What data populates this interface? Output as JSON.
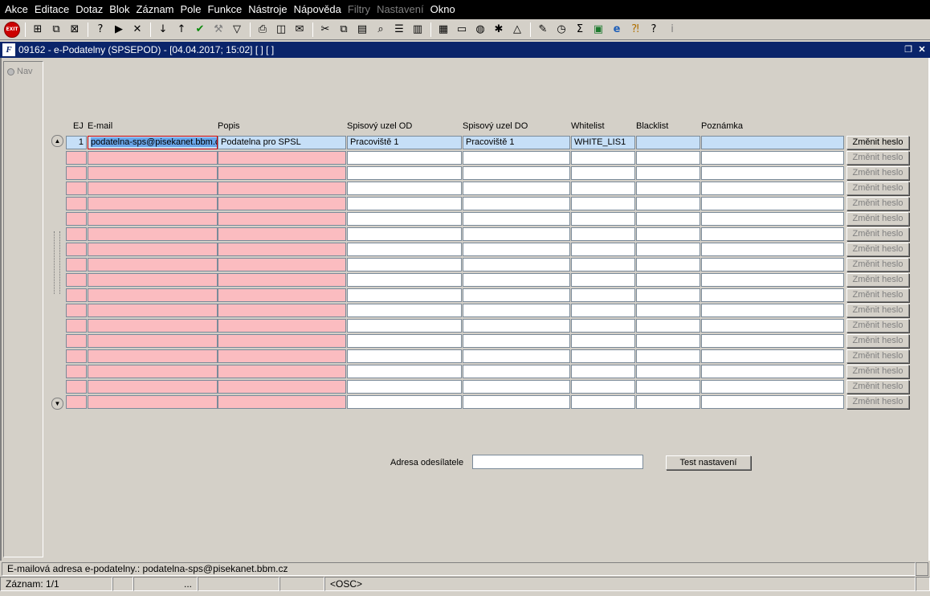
{
  "menu": [
    {
      "id": "akce",
      "label": "Akce",
      "disabled": false
    },
    {
      "id": "editace",
      "label": "Editace",
      "disabled": false
    },
    {
      "id": "dotaz",
      "label": "Dotaz",
      "disabled": false
    },
    {
      "id": "blok",
      "label": "Blok",
      "disabled": false
    },
    {
      "id": "zaznam",
      "label": "Záznam",
      "disabled": false
    },
    {
      "id": "pole",
      "label": "Pole",
      "disabled": false
    },
    {
      "id": "funkce",
      "label": "Funkce",
      "disabled": false
    },
    {
      "id": "nastroje",
      "label": "Nástroje",
      "disabled": false
    },
    {
      "id": "napoveda",
      "label": "Nápověda",
      "disabled": false
    },
    {
      "id": "filtry",
      "label": "Filtry",
      "disabled": true
    },
    {
      "id": "nastaveni",
      "label": "Nastavení",
      "disabled": true
    },
    {
      "id": "okno",
      "label": "Okno",
      "disabled": false
    }
  ],
  "toolbar": {
    "exit_label": "EXIT",
    "icons": [
      "exit-icon",
      "sep",
      "insert-record-icon",
      "duplicate-record-icon",
      "delete-record-icon",
      "sep",
      "query-enter-icon",
      "query-execute-icon",
      "query-cancel-icon",
      "sep",
      "sort-asc-icon",
      "sort-desc-icon",
      "commit-check-icon",
      "wrench-icon",
      "filter-icon",
      "sep",
      "print-icon",
      "print-preview-icon",
      "mail-icon",
      "sep",
      "cut-icon",
      "copy-icon",
      "paste-icon",
      "find-icon",
      "list-icon",
      "columns-icon",
      "sep",
      "calendar-icon",
      "document-icon",
      "globe-icon",
      "settings-icon",
      "triangle-icon",
      "sep",
      "edit-icon",
      "clock-icon",
      "sum-icon",
      "excel-icon",
      "ie-icon",
      "help-folder-icon",
      "help-icon",
      "info-icon"
    ]
  },
  "window": {
    "title": "09162 - e-Podatelny (SPSEPOD) - [04.04.2017; 15:02]  [ ]  [ ]",
    "app_icon": "F"
  },
  "nav": {
    "label": "Nav"
  },
  "columns": [
    {
      "key": "ej",
      "label": "EJ"
    },
    {
      "key": "email",
      "label": "E-mail"
    },
    {
      "key": "popis",
      "label": "Popis"
    },
    {
      "key": "od",
      "label": "Spisový uzel OD"
    },
    {
      "key": "do",
      "label": "Spisový uzel DO"
    },
    {
      "key": "whitelist",
      "label": "Whitelist"
    },
    {
      "key": "blacklist",
      "label": "Blacklist"
    },
    {
      "key": "poznamka",
      "label": "Poznámka"
    }
  ],
  "rows": [
    {
      "ej": "1",
      "email": "podatelna-sps@pisekanet.bbm.cz",
      "popis": "Podatelna pro SPSL",
      "od": "Pracoviště 1",
      "do": "Pracoviště 1",
      "whitelist": "WHITE_LIS1",
      "blacklist": "",
      "poznamka": "",
      "btn": "Změnit heslo",
      "active": true
    },
    {
      "ej": "",
      "email": "",
      "popis": "",
      "od": "",
      "do": "",
      "whitelist": "",
      "blacklist": "",
      "poznamka": "",
      "btn": "Změnit heslo",
      "active": false
    },
    {
      "ej": "",
      "email": "",
      "popis": "",
      "od": "",
      "do": "",
      "whitelist": "",
      "blacklist": "",
      "poznamka": "",
      "btn": "Změnit heslo",
      "active": false
    },
    {
      "ej": "",
      "email": "",
      "popis": "",
      "od": "",
      "do": "",
      "whitelist": "",
      "blacklist": "",
      "poznamka": "",
      "btn": "Změnit heslo",
      "active": false
    },
    {
      "ej": "",
      "email": "",
      "popis": "",
      "od": "",
      "do": "",
      "whitelist": "",
      "blacklist": "",
      "poznamka": "",
      "btn": "Změnit heslo",
      "active": false
    },
    {
      "ej": "",
      "email": "",
      "popis": "",
      "od": "",
      "do": "",
      "whitelist": "",
      "blacklist": "",
      "poznamka": "",
      "btn": "Změnit heslo",
      "active": false
    },
    {
      "ej": "",
      "email": "",
      "popis": "",
      "od": "",
      "do": "",
      "whitelist": "",
      "blacklist": "",
      "poznamka": "",
      "btn": "Změnit heslo",
      "active": false
    },
    {
      "ej": "",
      "email": "",
      "popis": "",
      "od": "",
      "do": "",
      "whitelist": "",
      "blacklist": "",
      "poznamka": "",
      "btn": "Změnit heslo",
      "active": false
    },
    {
      "ej": "",
      "email": "",
      "popis": "",
      "od": "",
      "do": "",
      "whitelist": "",
      "blacklist": "",
      "poznamka": "",
      "btn": "Změnit heslo",
      "active": false
    },
    {
      "ej": "",
      "email": "",
      "popis": "",
      "od": "",
      "do": "",
      "whitelist": "",
      "blacklist": "",
      "poznamka": "",
      "btn": "Změnit heslo",
      "active": false
    },
    {
      "ej": "",
      "email": "",
      "popis": "",
      "od": "",
      "do": "",
      "whitelist": "",
      "blacklist": "",
      "poznamka": "",
      "btn": "Změnit heslo",
      "active": false
    },
    {
      "ej": "",
      "email": "",
      "popis": "",
      "od": "",
      "do": "",
      "whitelist": "",
      "blacklist": "",
      "poznamka": "",
      "btn": "Změnit heslo",
      "active": false
    },
    {
      "ej": "",
      "email": "",
      "popis": "",
      "od": "",
      "do": "",
      "whitelist": "",
      "blacklist": "",
      "poznamka": "",
      "btn": "Změnit heslo",
      "active": false
    },
    {
      "ej": "",
      "email": "",
      "popis": "",
      "od": "",
      "do": "",
      "whitelist": "",
      "blacklist": "",
      "poznamka": "",
      "btn": "Změnit heslo",
      "active": false
    },
    {
      "ej": "",
      "email": "",
      "popis": "",
      "od": "",
      "do": "",
      "whitelist": "",
      "blacklist": "",
      "poznamka": "",
      "btn": "Změnit heslo",
      "active": false
    },
    {
      "ej": "",
      "email": "",
      "popis": "",
      "od": "",
      "do": "",
      "whitelist": "",
      "blacklist": "",
      "poznamka": "",
      "btn": "Změnit heslo",
      "active": false
    },
    {
      "ej": "",
      "email": "",
      "popis": "",
      "od": "",
      "do": "",
      "whitelist": "",
      "blacklist": "",
      "poznamka": "",
      "btn": "Změnit heslo",
      "active": false
    },
    {
      "ej": "",
      "email": "",
      "popis": "",
      "od": "",
      "do": "",
      "whitelist": "",
      "blacklist": "",
      "poznamka": "",
      "btn": "Změnit heslo",
      "active": false
    }
  ],
  "sender": {
    "label": "Adresa odesílatele",
    "value": ""
  },
  "test_button": "Test nastavení",
  "status": {
    "hint": "E-mailová adresa e-podatelny.: podatelna-sps@pisekanet.bbm.cz",
    "record": "Záznam: 1/1",
    "seg2": "",
    "seg3": "...",
    "seg4": "",
    "seg5": "",
    "mode": "<OSC>"
  },
  "colors": {
    "pink": "#fbbcc0",
    "active_row": "#c6dff7",
    "title_bar": "#0a246a",
    "focus_border": "#cc0000"
  }
}
